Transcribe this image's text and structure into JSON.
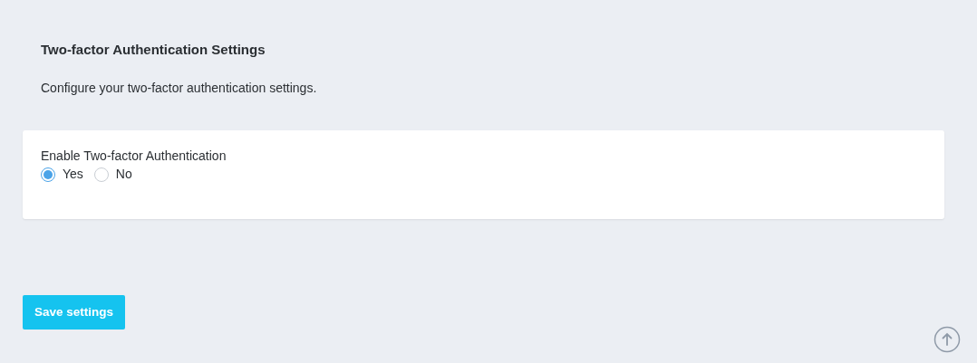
{
  "heading": "Two-factor Authentication Settings",
  "description": "Configure your two-factor authentication settings.",
  "setting": {
    "label": "Enable Two-factor Authentication",
    "options": [
      {
        "label": "Yes",
        "selected": true
      },
      {
        "label": "No",
        "selected": false
      }
    ]
  },
  "save_button": "Save settings"
}
